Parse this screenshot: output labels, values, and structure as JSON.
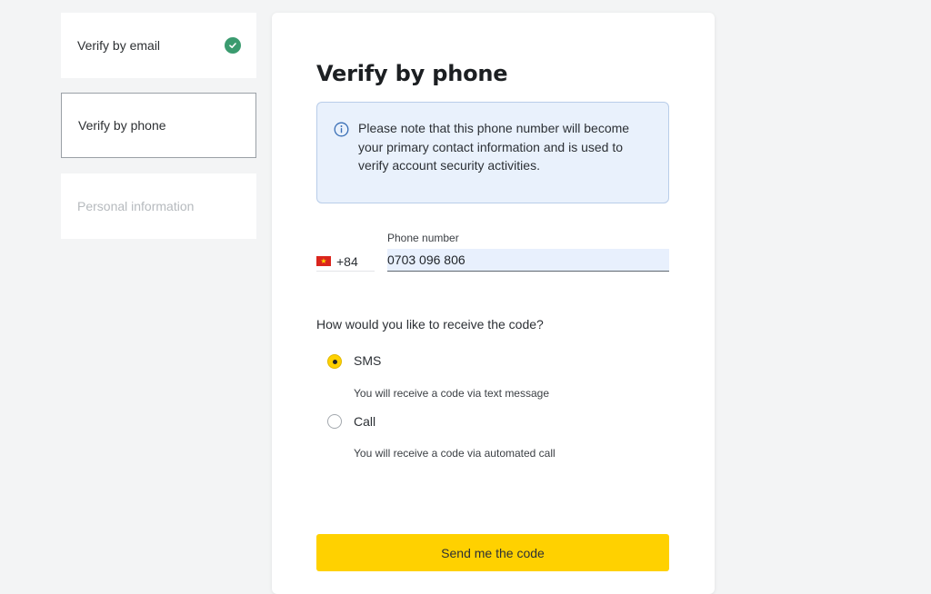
{
  "sidebar": {
    "steps": [
      {
        "label": "Verify by email",
        "status": "completed"
      },
      {
        "label": "Verify by phone",
        "status": "active"
      },
      {
        "label": "Personal information",
        "status": "disabled"
      }
    ]
  },
  "main": {
    "title": "Verify by phone",
    "notice": "Please note that this phone number will become your primary contact information and is used to verify account security activities.",
    "country_code": "+84",
    "country_flag": "vietnam-flag-icon",
    "phone_label": "Phone number",
    "phone_value": "0703 096 806",
    "question": "How would you like to receive the code?",
    "options": [
      {
        "label": "SMS",
        "description": "You will receive a code via text message",
        "selected": true
      },
      {
        "label": "Call",
        "description": "You will receive a code via automated call",
        "selected": false
      }
    ],
    "submit_label": "Send me the code"
  },
  "colors": {
    "accent": "#ffd100",
    "success": "#3a9b6f",
    "notice_bg": "#e9f1fc",
    "notice_border": "#b9cde9",
    "page_bg": "#f3f4f5"
  }
}
